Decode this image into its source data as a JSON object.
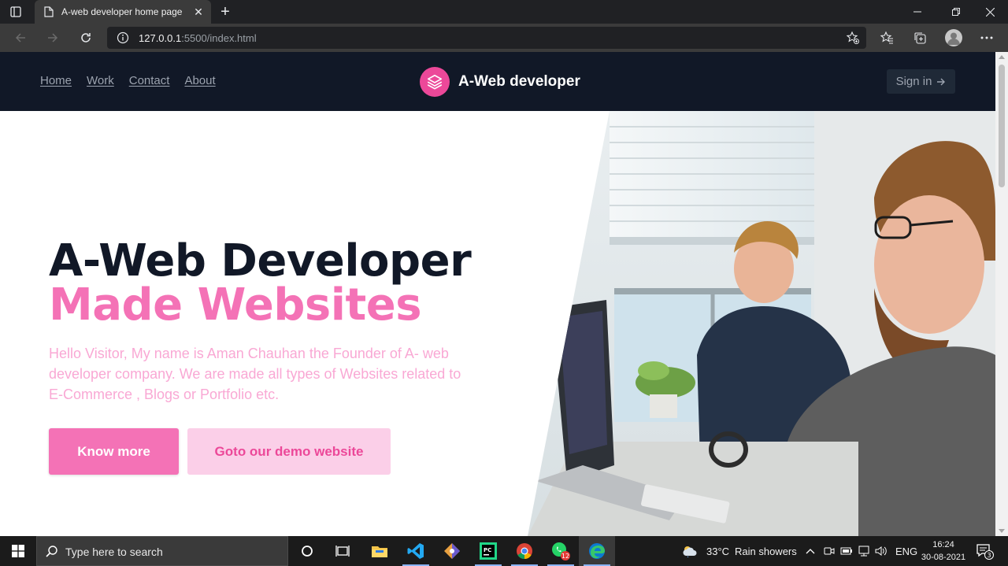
{
  "browser": {
    "tab_title": "A-web developer home page",
    "url_host": "127.0.0.1",
    "url_rest": ":5500/index.html"
  },
  "site": {
    "nav": [
      "Home",
      "Work",
      "Contact",
      "About"
    ],
    "brand_name": "A-Web developer",
    "signin_label": "Sign in",
    "brand_color": "#ec4899"
  },
  "hero": {
    "title_line1": "A-Web Developer",
    "title_line2": "Made Websites",
    "description": "Hello Visitor, My name is Aman Chauhan the Founder of A- web developer company. We are made all types of Websites related to E-Commerce , Blogs or Portfolio etc.",
    "primary_button": "Know more",
    "secondary_button": "Goto our demo website"
  },
  "taskbar": {
    "search_placeholder": "Type here to search",
    "weather_temp": "33°C",
    "weather_text": "Rain showers",
    "language": "ENG",
    "time": "16:24",
    "date": "30-08-2021",
    "whatsapp_badge": "12",
    "notification_count": "3"
  }
}
